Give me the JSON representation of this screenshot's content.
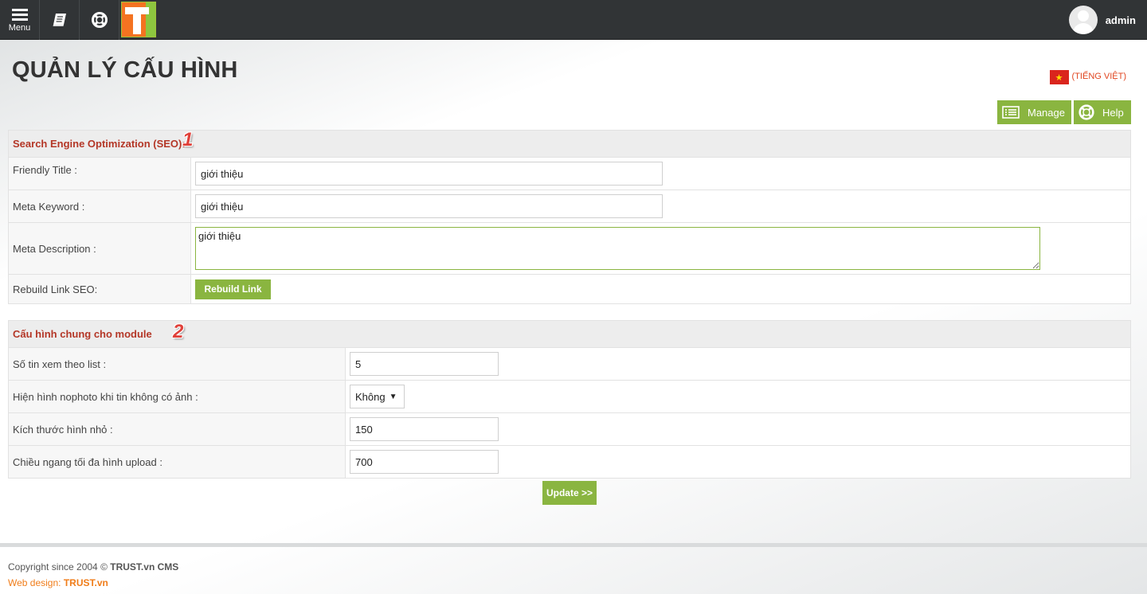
{
  "topbar": {
    "menu_label": "Menu",
    "user_name": "admin"
  },
  "page": {
    "title": "QUẢN LÝ CẤU HÌNH",
    "language": "(TIẾNG VIỆT)",
    "actions": {
      "manage": "Manage",
      "help": "Help"
    }
  },
  "seo": {
    "heading": "Search Engine Optimization (SEO):",
    "marker": "1",
    "friendly_title_label": "Friendly Title :",
    "friendly_title_value": "giới thiệu",
    "meta_keyword_label": "Meta Keyword :",
    "meta_keyword_value": "giới thiệu",
    "meta_description_label": "Meta Description :",
    "meta_description_value": "giới thiệu",
    "rebuild_label": "Rebuild Link SEO:",
    "rebuild_button": "Rebuild Link"
  },
  "module": {
    "heading": "Cấu hình chung cho module",
    "marker": "2",
    "items_per_list_label": "Số tin xem theo list :",
    "items_per_list_value": "5",
    "nophoto_label": "Hiện hình nophoto khi tin không có ảnh :",
    "nophoto_value": "Không",
    "thumb_size_label": "Kích thước hình nhỏ :",
    "thumb_size_value": "150",
    "max_width_label": "Chiều ngang tối đa hình upload :",
    "max_width_value": "700",
    "update_button": "Update >>"
  },
  "footer": {
    "copyright_prefix": "Copyright since 2004 ©",
    "copyright_brand": "TRUST.vn CMS",
    "design_prefix": "Web design:",
    "design_brand": "TRUST.vn"
  },
  "colors": {
    "accent_green": "#8ab540",
    "heading_red": "#b43727",
    "topbar": "#313436",
    "brand_orange": "#f47321"
  }
}
